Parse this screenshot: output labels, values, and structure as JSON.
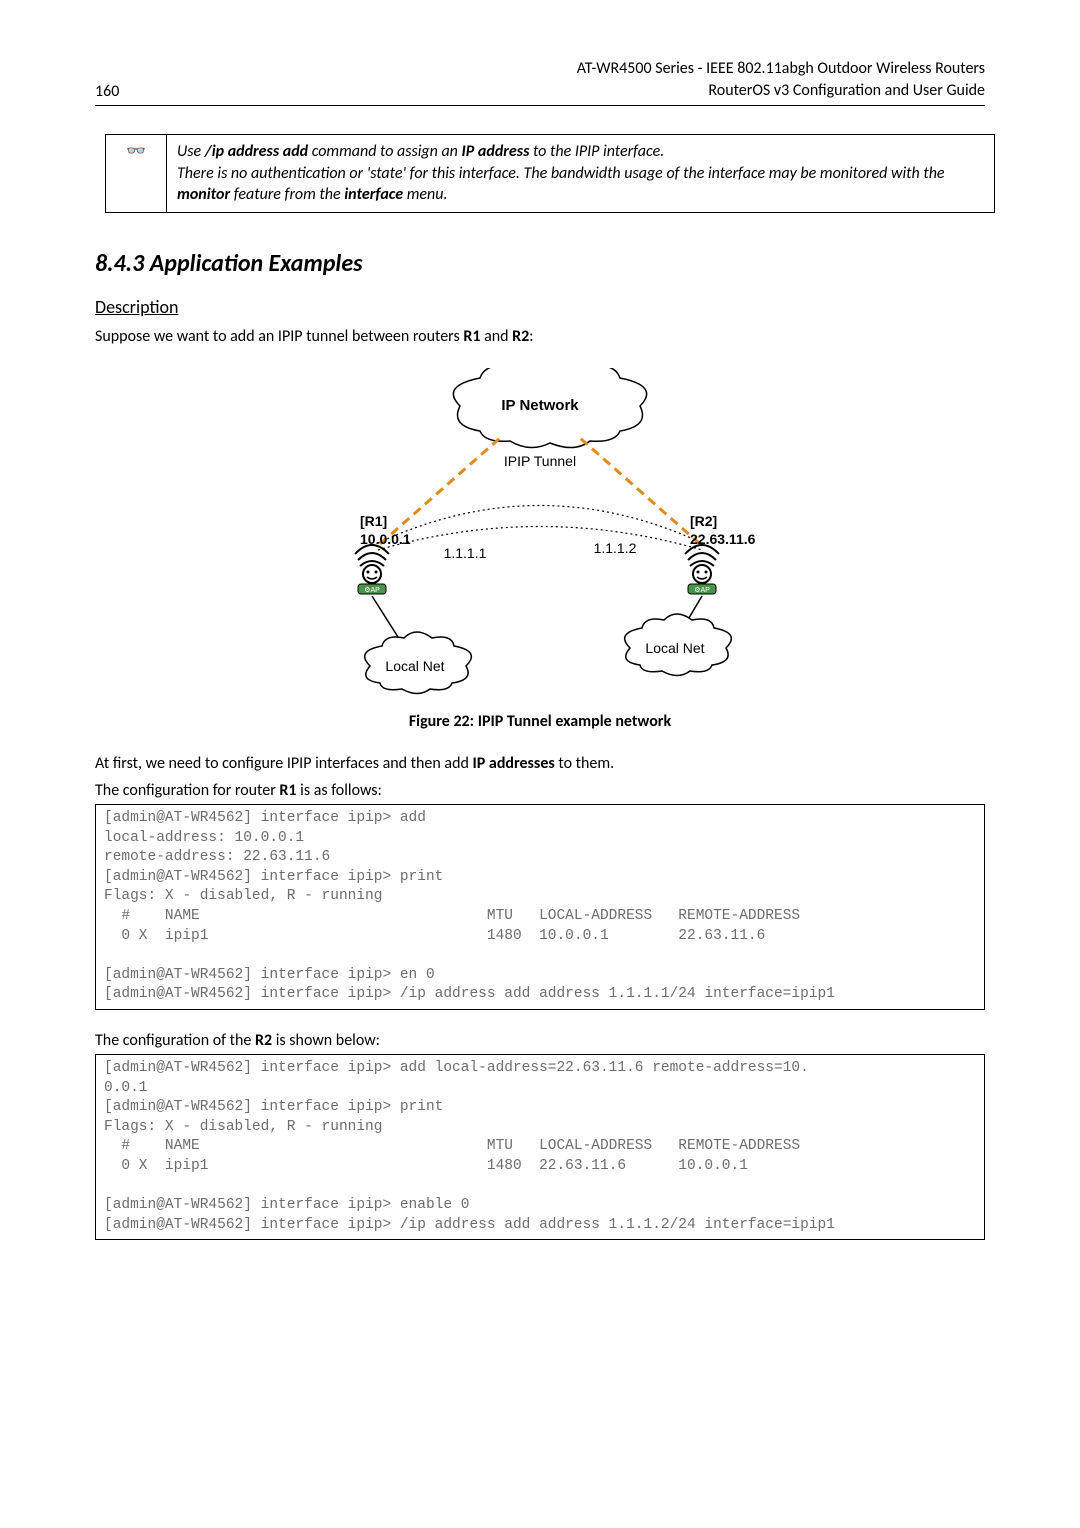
{
  "header": {
    "page_number": "160",
    "title_line1": "AT-WR4500 Series - IEEE 802.11abgh Outdoor Wireless Routers",
    "title_line2": "RouterOS v3 Configuration and User Guide"
  },
  "note": {
    "icon": "👓",
    "prefix": "Use ",
    "cmd": "/ip address add",
    "mid1": " command to assign an ",
    "ipaddr": "IP address",
    "mid2": " to the IPIP interface.",
    "line2a": "There is no authentication or 'state' for this interface. The bandwidth usage of the interface may be monitored with the ",
    "monitor": "monitor",
    "line2b": " feature from the ",
    "interface": "interface",
    "line2c": " menu."
  },
  "section": {
    "number_title": "8.4.3 Application Examples",
    "description_heading": "Description",
    "intro_a": "Suppose we want to add an IPIP tunnel between routers ",
    "r1": "R1",
    "intro_b": " and ",
    "r2": "R2",
    "intro_c": ":"
  },
  "diagram": {
    "ip_network": "IP Network",
    "ipip_tunnel": "IPIP Tunnel",
    "r1_label": "[R1]",
    "r1_addr": "10.0.0.1",
    "r2_label": "[R2]",
    "r2_addr": "22.63.11.6",
    "tunnel_left": "1.1.1.1",
    "tunnel_right": "1.1.1.2",
    "local_net": "Local Net"
  },
  "figure_caption": "Figure 22: IPIP Tunnel example network",
  "para2_a": "At first, we need to configure IPIP interfaces and then add ",
  "para2_b": "IP addresses",
  "para2_c": " to them.",
  "para3_a": "The configuration for router ",
  "para3_b": "R1",
  "para3_c": " is as follows:",
  "code1": "[admin@AT-WR4562] interface ipip> add \nlocal-address: 10.0.0.1\nremote-address: 22.63.11.6 \n[admin@AT-WR4562] interface ipip> print \nFlags: X - disabled, R - running \n  #    NAME                                 MTU   LOCAL-ADDRESS   REMOTE-ADDRESS \n  0 X  ipip1                                1480  10.0.0.1        22.63.11.6      \n \n[admin@AT-WR4562] interface ipip> en 0 \n[admin@AT-WR4562] interface ipip> /ip address add address 1.1.1.1/24 interface=ipip1",
  "para4_a": "The configuration of the ",
  "para4_b": "R2",
  "para4_c": " is shown below:",
  "code2": "[admin@AT-WR4562] interface ipip> add local-address=22.63.11.6 remote-address=10.\n0.0.1                                                                               \n[admin@AT-WR4562] interface ipip> print \nFlags: X - disabled, R - running \n  #    NAME                                 MTU   LOCAL-ADDRESS   REMOTE-ADDRESS \n  0 X  ipip1                                1480  22.63.11.6      10.0.0.1        \n \n[admin@AT-WR4562] interface ipip> enable 0 \n[admin@AT-WR4562] interface ipip> /ip address add address 1.1.1.2/24 interface=ipip1"
}
